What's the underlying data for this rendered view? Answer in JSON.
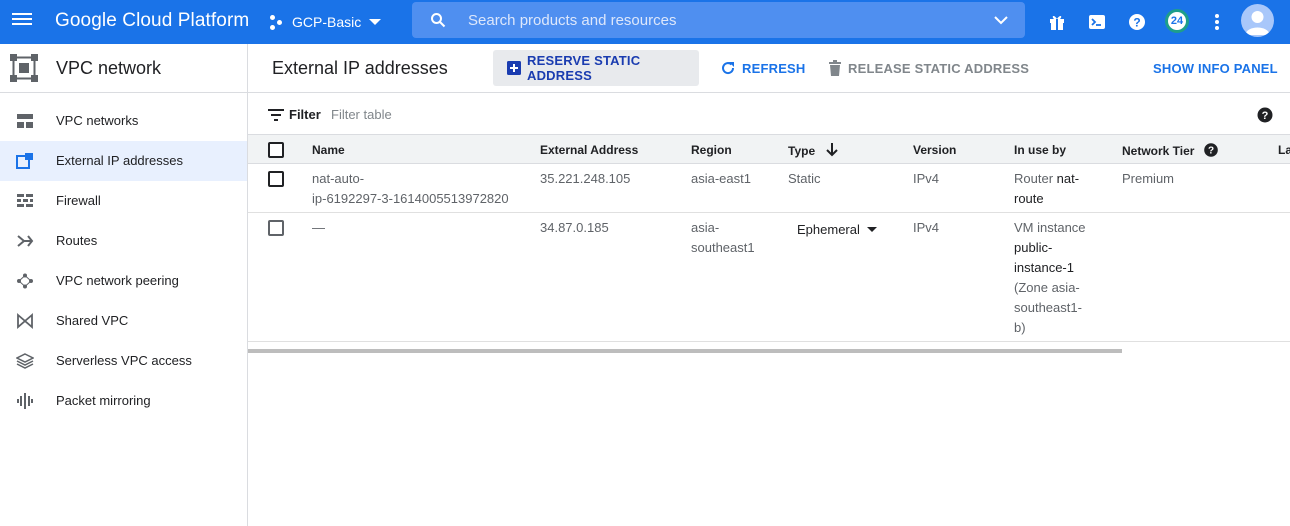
{
  "topbar": {
    "brand": "Google Cloud Platform",
    "project": "GCP-Basic",
    "search_placeholder": "Search products and resources",
    "notification_count": "24"
  },
  "sidebar": {
    "title": "VPC network",
    "items": [
      {
        "label": "VPC networks",
        "icon": "vpc-networks-icon",
        "active": false
      },
      {
        "label": "External IP addresses",
        "icon": "external-ip-icon",
        "active": true
      },
      {
        "label": "Firewall",
        "icon": "firewall-icon",
        "active": false
      },
      {
        "label": "Routes",
        "icon": "routes-icon",
        "active": false
      },
      {
        "label": "VPC network peering",
        "icon": "peering-icon",
        "active": false
      },
      {
        "label": "Shared VPC",
        "icon": "shared-vpc-icon",
        "active": false
      },
      {
        "label": "Serverless VPC access",
        "icon": "serverless-icon",
        "active": false
      },
      {
        "label": "Packet mirroring",
        "icon": "packet-mirroring-icon",
        "active": false
      }
    ]
  },
  "page": {
    "title": "External IP addresses",
    "actions": {
      "reserve": "RESERVE STATIC ADDRESS",
      "refresh": "REFRESH",
      "release": "RELEASE STATIC ADDRESS",
      "info": "SHOW INFO PANEL"
    }
  },
  "filter": {
    "label": "Filter",
    "placeholder": "Filter table"
  },
  "table": {
    "columns": [
      "Name",
      "External Address",
      "Region",
      "Type",
      "Version",
      "In use by",
      "Network Tier",
      "La"
    ],
    "rows": [
      {
        "name_line1": "nat-auto-",
        "name_line2": "ip-6192297-3-1614005513972820",
        "address": "35.221.248.105",
        "region_line1": "asia-east1",
        "region_line2": "",
        "type": "Static",
        "version": "IPv4",
        "inuse_prefix": "Router ",
        "inuse_link1": "nat-",
        "inuse_link2": "route",
        "tier": "Premium"
      },
      {
        "name_line1": "—",
        "name_line2": "",
        "address": "34.87.0.185",
        "region_line1": "asia-",
        "region_line2": "southeast1",
        "type": "Ephemeral",
        "version": "IPv4",
        "inuse_prefix": "VM instance",
        "inuse_link1": "public-",
        "inuse_link2": "instance-1",
        "inuse_zone1": "(Zone asia-",
        "inuse_zone2": "southeast1-",
        "inuse_zone3": "b)",
        "tier": ""
      }
    ]
  },
  "colors": {
    "topbar": "#1a73e8",
    "primary": "#1a73e8",
    "active_bg": "#e8f0fe",
    "header_bg": "#f1f3f4"
  }
}
